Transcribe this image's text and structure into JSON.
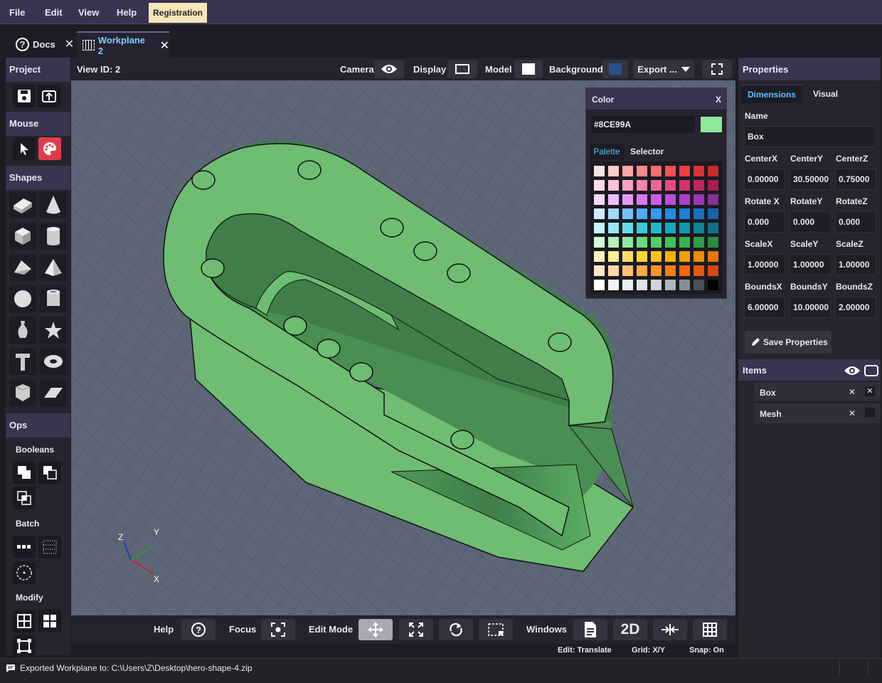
{
  "menubar": {
    "file": "File",
    "edit": "Edit",
    "view": "View",
    "help": "Help",
    "registration": "Registration"
  },
  "tabs": [
    {
      "label": "Docs"
    },
    {
      "label": "Workplane 2"
    }
  ],
  "sidebar": {
    "project": "Project",
    "mouse": "Mouse",
    "shapes": "Shapes",
    "ops": "Ops",
    "booleans": "Booleans",
    "batch": "Batch",
    "modify": "Modify"
  },
  "viewheader": {
    "view_id": "View ID: 2",
    "camera": "Camera",
    "display": "Display",
    "model": "Model",
    "background": "Background",
    "export": "Export ...",
    "background_color": "#2a5288"
  },
  "color_panel": {
    "title": "Color",
    "close": "X",
    "hex_value": "#8CE99A",
    "current_color": "#8ce99a",
    "tab_palette": "Palette",
    "tab_selector": "Selector",
    "palette_rows": [
      [
        "#ffe3e3",
        "#ffc9c9",
        "#ffa8a8",
        "#ff8787",
        "#ff6b6b",
        "#fa5252",
        "#f03e3e",
        "#e03131",
        "#c92a2a"
      ],
      [
        "#ffdeeb",
        "#fcc2d7",
        "#faa2c1",
        "#f783ac",
        "#f06595",
        "#e64980",
        "#d6336c",
        "#c2255c",
        "#a61e4d"
      ],
      [
        "#f3d9fa",
        "#eebefa",
        "#e599f7",
        "#da77f2",
        "#cc5de8",
        "#be4bdb",
        "#ae3ec9",
        "#9c36b5",
        "#862e9c"
      ],
      [
        "#d0ebff",
        "#a5d8ff",
        "#74c0fc",
        "#4dabf7",
        "#339af0",
        "#228be6",
        "#1c7ed6",
        "#1971c2",
        "#1864ab"
      ],
      [
        "#c5f6fa",
        "#99e9f2",
        "#66d9e8",
        "#3bc9db",
        "#22b8cf",
        "#15aabf",
        "#1098ad",
        "#0c8599",
        "#0b7285"
      ],
      [
        "#d3f9d8",
        "#b2f2bb",
        "#8ce99a",
        "#69db7c",
        "#51cf66",
        "#40c057",
        "#37b24d",
        "#2f9e44",
        "#2b8a3e"
      ],
      [
        "#fff3bf",
        "#ffec99",
        "#ffe066",
        "#ffd43b",
        "#fcc419",
        "#fab005",
        "#f59f00",
        "#f08c00",
        "#e67700"
      ],
      [
        "#ffe8cc",
        "#ffd8a8",
        "#ffc078",
        "#ffa94d",
        "#ff922b",
        "#fd7e14",
        "#f76707",
        "#e8590c",
        "#d9480f"
      ],
      [
        "#ffffff",
        "#f1f3f5",
        "#e9ecef",
        "#dee2e6",
        "#ced4da",
        "#adb5bd",
        "#868e96",
        "#495057",
        "#343a40"
      ]
    ],
    "palette_last": "#000000"
  },
  "properties": {
    "title": "Properties",
    "tab_dimensions": "Dimensions",
    "tab_visual": "Visual",
    "name_label": "Name",
    "name_value": "Box",
    "labels_center": [
      "CenterX",
      "CenterY",
      "CenterZ"
    ],
    "values_center": [
      "0.00000",
      "30.50000",
      "0.75000"
    ],
    "labels_rotate": [
      "Rotate X",
      "RotateY",
      "RotateZ"
    ],
    "values_rotate": [
      "0.000",
      "0.000",
      "0.000"
    ],
    "labels_scale": [
      "ScaleX",
      "ScaleY",
      "ScaleZ"
    ],
    "values_scale": [
      "1.00000",
      "1.00000",
      "1.00000"
    ],
    "labels_bounds": [
      "BoundsX",
      "BoundsY",
      "BoundsZ"
    ],
    "values_bounds": [
      "6.00000",
      "10.00000",
      "2.00000"
    ],
    "save_button": "Save Properties",
    "items_title": "Items",
    "items": [
      {
        "name": "Box"
      },
      {
        "name": "Mesh"
      }
    ]
  },
  "bottom": {
    "help": "Help",
    "focus": "Focus",
    "edit_mode": "Edit Mode",
    "windows": "Windows",
    "two_d": "2D"
  },
  "status_line": {
    "edit": "Edit: Translate",
    "grid": "Grid: X/Y",
    "snap": "Snap: On"
  },
  "statusbar": {
    "message": "Exported Workplane to: C:\\Users\\Z\\Desktop\\hero-shape-4.zip"
  },
  "axes": {
    "x": "X",
    "y": "Y",
    "z": "Z"
  },
  "colors": {
    "menubar": "#3a3350",
    "accent": "#6b63a0",
    "model_green": "#6fbf73",
    "viewport_bg": "#5d6676"
  }
}
